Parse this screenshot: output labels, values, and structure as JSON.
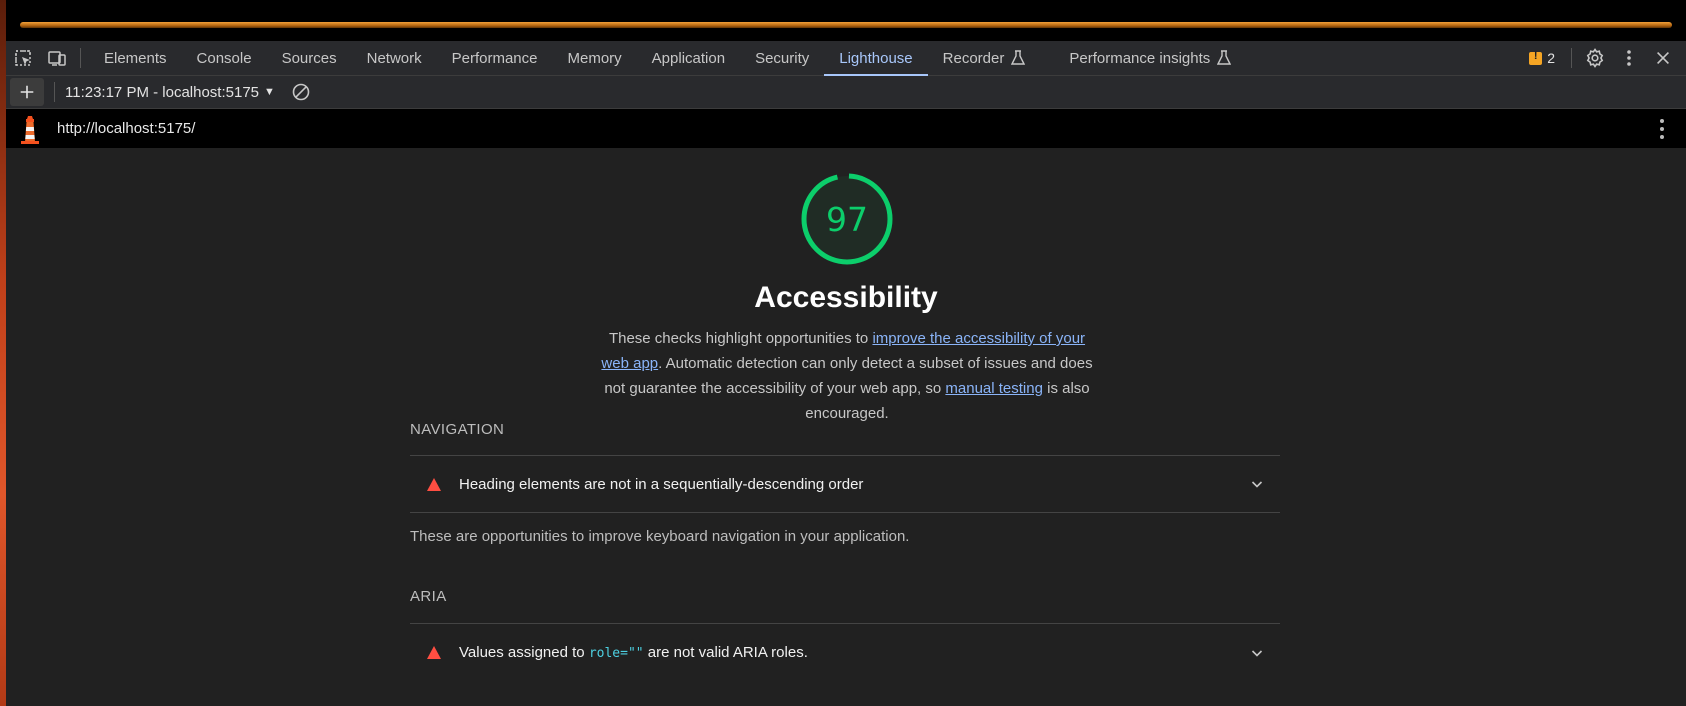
{
  "devtools": {
    "tabs": [
      {
        "label": "Elements"
      },
      {
        "label": "Console"
      },
      {
        "label": "Sources"
      },
      {
        "label": "Network"
      },
      {
        "label": "Performance"
      },
      {
        "label": "Memory"
      },
      {
        "label": "Application"
      },
      {
        "label": "Security"
      },
      {
        "label": "Lighthouse",
        "active": true
      },
      {
        "label": "Recorder",
        "experimental": true
      },
      {
        "label": "Performance insights",
        "experimental": true
      }
    ],
    "issues_count": "2"
  },
  "lighthouse": {
    "report_select": "11:23:17 PM - localhost:5175",
    "url": "http://localhost:5175/",
    "score": "97",
    "score_fraction": 0.97,
    "score_color": "#0cce6b",
    "category_title": "Accessibility",
    "description": {
      "part1": "These checks highlight opportunities to ",
      "link1": "improve the accessibility of your web app",
      "part2": ". Automatic detection can only detect a subset of issues and does not guarantee the accessibility of your web app, so ",
      "link2": "manual testing",
      "part3": " is also encouraged."
    },
    "groups": [
      {
        "title": "NAVIGATION",
        "audits": [
          {
            "title": "Heading elements are not in a sequentially-descending order",
            "status": "fail"
          }
        ],
        "description": "These are opportunities to improve keyboard navigation in your application."
      },
      {
        "title": "ARIA",
        "audits": [
          {
            "title_before": "Values assigned to ",
            "code": "role=\"\"",
            "title_after": " are not valid ARIA roles.",
            "status": "fail"
          }
        ]
      }
    ]
  },
  "colors": {
    "fail": "#ff4e42",
    "link": "#8ab4f8",
    "active_tab": "#a8c7fa",
    "issue_badge": "#f5a524"
  }
}
